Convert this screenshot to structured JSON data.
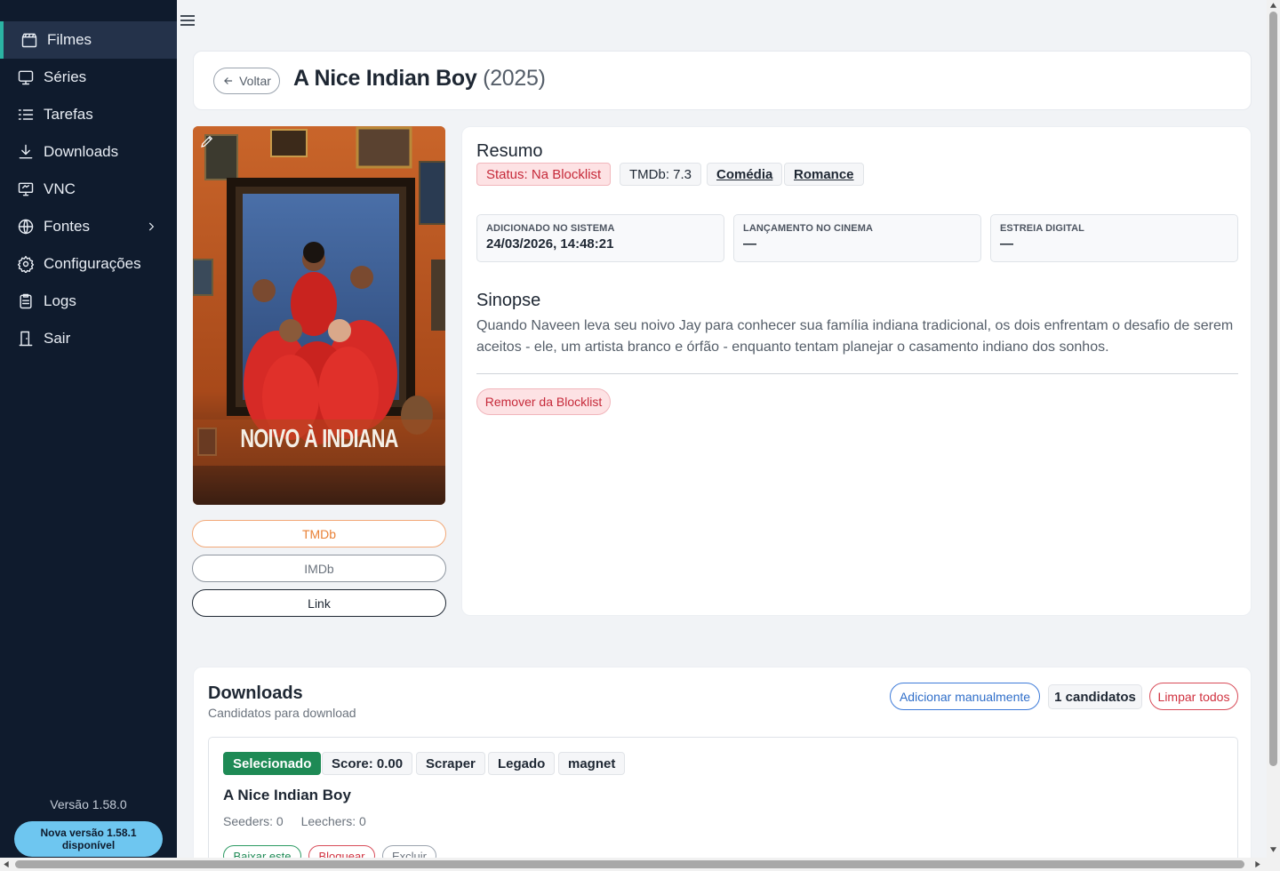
{
  "sidebar": {
    "items": [
      {
        "label": "Filmes",
        "icon": "clapperboard-icon"
      },
      {
        "label": "Séries",
        "icon": "tv-icon"
      },
      {
        "label": "Tarefas",
        "icon": "list-checks-icon"
      },
      {
        "label": "Downloads",
        "icon": "download-icon"
      },
      {
        "label": "VNC",
        "icon": "monitor-icon"
      },
      {
        "label": "Fontes",
        "icon": "globe-icon"
      },
      {
        "label": "Configurações",
        "icon": "gear-icon"
      },
      {
        "label": "Logs",
        "icon": "clipboard-icon"
      },
      {
        "label": "Sair",
        "icon": "door-exit-icon"
      }
    ],
    "version": "Versão 1.58.0",
    "update_line1": "Nova versão 1.58.1",
    "update_line2": "disponível",
    "colors": {
      "background": "#0f1b2d",
      "active_accent": "#2bb3a3",
      "update_pill": "#6ec6f0"
    }
  },
  "header": {
    "back_label": "Voltar",
    "title": "A Nice Indian Boy",
    "year": "(2025)"
  },
  "poster": {
    "caption": "NOIVO À INDIANA"
  },
  "external_links": {
    "tmdb": "TMDb",
    "imdb": "IMDb",
    "link": "Link"
  },
  "summary": {
    "heading": "Resumo",
    "status": "Status: Na Blocklist",
    "rating": "TMDb: 7.3",
    "genres": [
      "Comédia",
      "Romance"
    ],
    "info": [
      {
        "label": "ADICIONADO NO SISTEMA",
        "value": "24/03/2026, 14:48:21"
      },
      {
        "label": "LANÇAMENTO NO CINEMA",
        "value": "—"
      },
      {
        "label": "ESTREIA DIGITAL",
        "value": "—"
      }
    ],
    "synopsis_heading": "Sinopse",
    "synopsis": "Quando Naveen leva seu noivo Jay para conhecer sua família indiana tradicional, os dois enfrentam o desafio de serem aceitos - ele, um artista branco e órfão - enquanto tentam planejar o casamento indiano dos sonhos.",
    "remove_label": "Remover da Blocklist"
  },
  "downloads": {
    "title": "Downloads",
    "subtitle": "Candidatos para download",
    "add_label": "Adicionar manualmente",
    "count_label": "1 candidatos",
    "clear_label": "Limpar todos",
    "candidate": {
      "tags": [
        "Selecionado",
        "Score: 0.00",
        "Scraper",
        "Legado",
        "magnet"
      ],
      "name": "A Nice Indian Boy",
      "seeders": "Seeders: 0",
      "leechers": "Leechers: 0",
      "actions": [
        "Baixar este",
        "Bloquear",
        "Excluir"
      ]
    }
  }
}
